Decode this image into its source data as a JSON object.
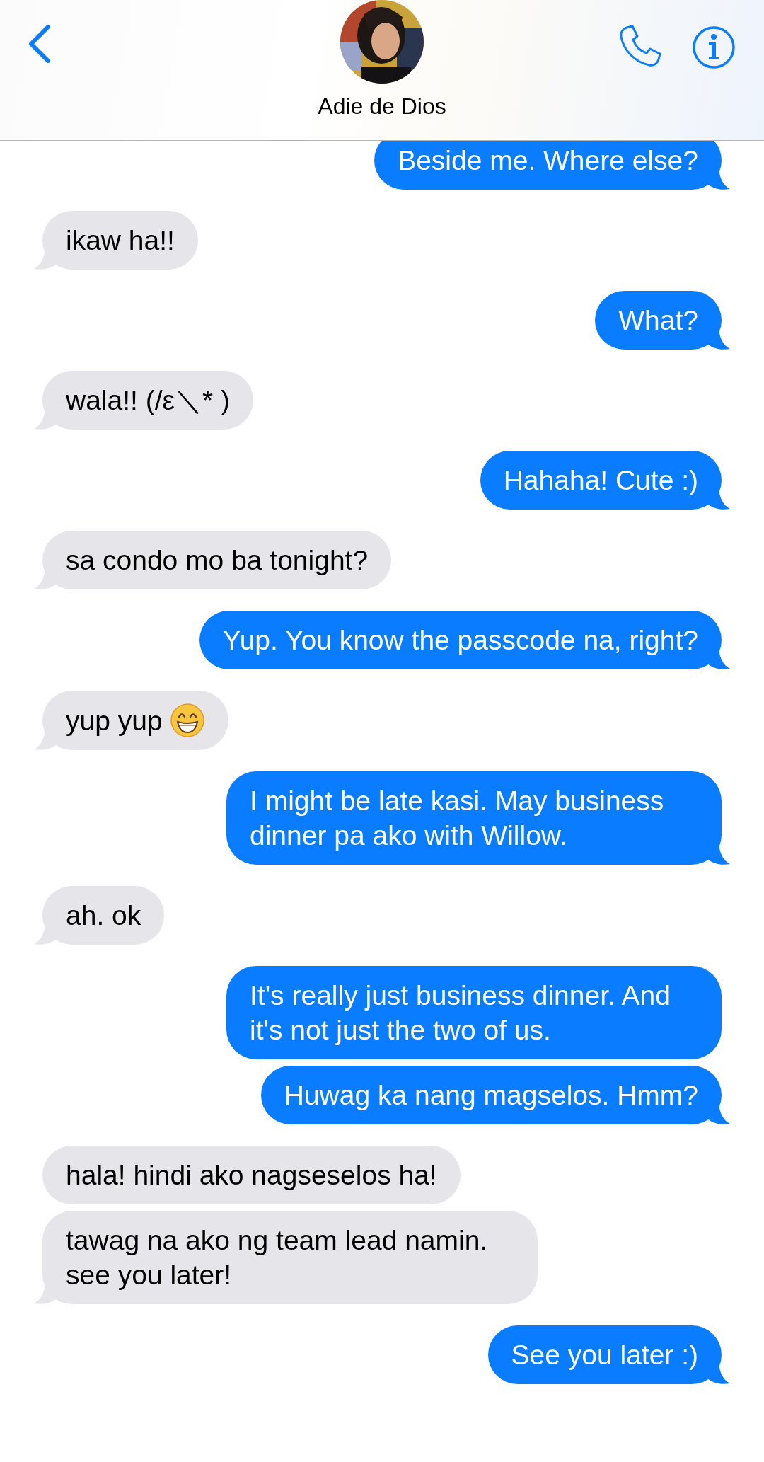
{
  "header": {
    "contact_name": "Adie de Dios"
  },
  "messages": [
    {
      "kind": "sent",
      "text": "Beside me. Where else?",
      "tail": true
    },
    {
      "kind": "received",
      "text": "ikaw ha!!",
      "tail": true
    },
    {
      "kind": "sent",
      "text": "What?",
      "tail": true
    },
    {
      "kind": "received",
      "text": "wala!! (/ε＼* )",
      "tail": true
    },
    {
      "kind": "sent",
      "text": "Hahaha! Cute :)",
      "tail": true
    },
    {
      "kind": "received",
      "text": "sa condo mo ba tonight?",
      "tail": true
    },
    {
      "kind": "sent",
      "text": "Yup. You know the passcode na, right?",
      "tail": true
    },
    {
      "kind": "received",
      "text": "yup yup",
      "emoji": true,
      "tail": true
    },
    {
      "kind": "sent",
      "text": "I might be late kasi. May business dinner pa ako with Willow.",
      "tail": true
    },
    {
      "kind": "received",
      "text": "ah. ok",
      "tail": true
    },
    {
      "kind": "sent",
      "text": "It's really just business dinner. And it's not just the two of us.",
      "tail": false
    },
    {
      "kind": "sent",
      "text": "Huwag ka nang magselos. Hmm?",
      "tail": true
    },
    {
      "kind": "received",
      "text": "hala! hindi ako nagseselos ha!",
      "tail": false
    },
    {
      "kind": "received",
      "text": "tawag na ako ng team lead namin. see you later!",
      "tail": true
    },
    {
      "kind": "sent",
      "text": "See you later :)",
      "tail": true
    }
  ]
}
